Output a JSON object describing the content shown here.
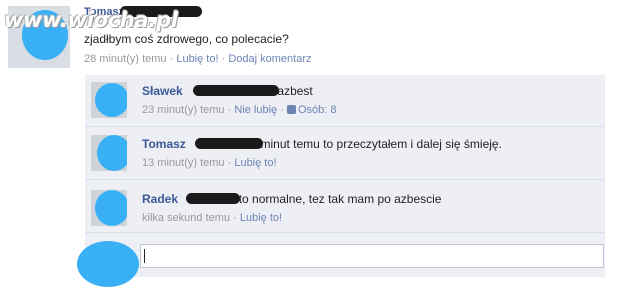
{
  "watermark": "www.wiocha.pl",
  "post": {
    "author": "Tomasz",
    "text": "zjadłbym coś zdrowego, co polecacie?",
    "time": "28 minut(y) temu",
    "like": "Lubię to!",
    "comment": "Dodaj komentarz",
    "separator": "·"
  },
  "comments": [
    {
      "author": "Sławek",
      "text": "azbest",
      "time": "23 minut(y) temu",
      "unlike": "Nie lubię",
      "likes": "Osób: 8"
    },
    {
      "author": "Tomasz",
      "text": "9 minut temu to przeczytałem i dalej się śmieję.",
      "time": "13 minut(y) temu",
      "like": "Lubię to!"
    },
    {
      "author": "Radek",
      "text": "to normalne, tez tak mam po azbescie",
      "time": "kilka sekund temu",
      "like": "Lubię to!"
    }
  ],
  "colors": {
    "link": "#3b5998",
    "meta": "#999999",
    "comment_bg": "#edeff4",
    "censor": "#39b0f5"
  }
}
